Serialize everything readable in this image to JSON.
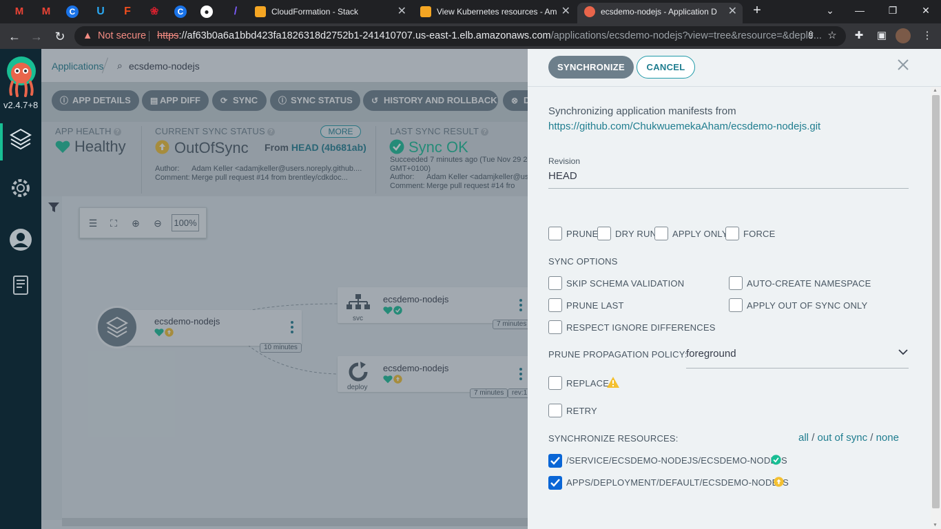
{
  "browser": {
    "pinned_tabs": [
      {
        "icon": "gmail-icon",
        "glyph": "M",
        "color": "#ea4335"
      },
      {
        "icon": "gmail-icon",
        "glyph": "M",
        "color": "#ea4335"
      },
      {
        "icon": "c-app-icon",
        "glyph": "C",
        "color": "#1a73e8"
      },
      {
        "icon": "u-app-icon",
        "glyph": "U",
        "color": "#2aa8f2"
      },
      {
        "icon": "figma-icon",
        "glyph": "F",
        "color": "#f24e1e"
      },
      {
        "icon": "huawei-icon",
        "glyph": "❀",
        "color": "#d1212e"
      },
      {
        "icon": "c-app-icon",
        "glyph": "C",
        "color": "#1a73e8"
      },
      {
        "icon": "github-icon",
        "glyph": "●",
        "color": "#444"
      },
      {
        "icon": "tool-icon",
        "glyph": "/",
        "color": "#7a5af8"
      }
    ],
    "tabs": [
      {
        "title": "CloudFormation - Stack",
        "active": false,
        "icon_color": "#f5a623"
      },
      {
        "title": "View Kubernetes resources - Am",
        "active": false,
        "icon_color": "#f5a623"
      },
      {
        "title": "ecsdemo-nodejs - Application D",
        "active": true,
        "icon_color": "#e9654b"
      }
    ],
    "new_tab": "+",
    "not_secure": "Not secure",
    "url_scheme": "https",
    "url_host": "://af63b0a6a1bbd423fa1826318d2752b1-241410707.us-east-1.elb.amazonaws.com",
    "url_path": "/applications/ecsdemo-nodejs?view=tree&resource=&deplo..."
  },
  "argo_nav": {
    "version": "v2.4.7+8",
    "items": [
      {
        "icon": "layers-icon",
        "active": true
      },
      {
        "icon": "settings-gear-icon",
        "active": false
      },
      {
        "icon": "user-icon",
        "active": false
      },
      {
        "icon": "docs-icon",
        "active": false
      }
    ]
  },
  "main": {
    "breadcrumb": {
      "root": "Applications",
      "current": "ecsdemo-nodejs"
    },
    "actions": [
      {
        "label": "APP DETAILS",
        "icon": "info-icon",
        "glyph": "ⓘ"
      },
      {
        "label": "APP DIFF",
        "icon": "file-icon",
        "glyph": "▤"
      },
      {
        "label": "SYNC",
        "icon": "sync-icon",
        "glyph": "⟳"
      },
      {
        "label": "SYNC STATUS",
        "icon": "info-icon",
        "glyph": "ⓘ"
      },
      {
        "label": "HISTORY AND ROLLBACK",
        "icon": "history-icon",
        "glyph": "↺"
      },
      {
        "label": "D",
        "icon": "delete-icon",
        "glyph": "⊗"
      }
    ],
    "app_health": {
      "title": "APP HEALTH",
      "value": "Healthy"
    },
    "sync_status": {
      "title": "CURRENT SYNC STATUS",
      "more": "MORE",
      "value": "OutOfSync",
      "from_label": "From",
      "revision": "HEAD (4b681ab)",
      "author_label": "Author:",
      "author": "Adam Keller <adamjkeller@users.noreply.github....",
      "comment_label": "Comment:",
      "comment": "Merge pull request #14 from brentley/cdkdoc..."
    },
    "last_sync": {
      "title": "LAST SYNC RESULT",
      "value": "Sync OK",
      "succeeded": "Succeeded 7 minutes ago (Tue Nov 29 2",
      "tz": "GMT+0100)",
      "author_label": "Author:",
      "author": "Adam Keller <adamjkeller@user",
      "comment_label": "Comment:",
      "comment": "Merge pull request #14 fro"
    },
    "zoom": "100%",
    "graph": {
      "app_node": {
        "name": "ecsdemo-nodejs",
        "age": "10 minutes"
      },
      "svc_node": {
        "name": "ecsdemo-nodejs",
        "kind": "svc",
        "age": "7 minutes"
      },
      "deploy_node": {
        "name": "ecsdemo-nodejs",
        "kind": "deploy",
        "age": "7 minutes",
        "rev": "rev:1"
      }
    }
  },
  "panel": {
    "synchronize_label": "SYNCHRONIZE",
    "cancel_label": "CANCEL",
    "intro": "Synchronizing application manifests from",
    "repo_url": "https://github.com/ChukwuemekaAham/ecsdemo-nodejs.git",
    "revision_label": "Revision",
    "revision_value": "HEAD",
    "flags": [
      {
        "label": "PRUNE",
        "checked": false
      },
      {
        "label": "DRY RUN",
        "checked": false
      },
      {
        "label": "APPLY ONLY",
        "checked": false
      },
      {
        "label": "FORCE",
        "checked": false
      }
    ],
    "sync_options_title": "SYNC OPTIONS",
    "sync_options": [
      {
        "label": "SKIP SCHEMA VALIDATION",
        "checked": false
      },
      {
        "label": "AUTO-CREATE NAMESPACE",
        "checked": false
      },
      {
        "label": "PRUNE LAST",
        "checked": false
      },
      {
        "label": "APPLY OUT OF SYNC ONLY",
        "checked": false
      },
      {
        "label": "RESPECT IGNORE DIFFERENCES",
        "checked": false
      }
    ],
    "prune_policy_label": "PRUNE PROPAGATION POLICY:",
    "prune_policy_value": "foreground",
    "replace_label": "REPLACE",
    "retry_label": "RETRY",
    "resources_title": "SYNCHRONIZE RESOURCES:",
    "select_all": "all",
    "select_outofsync": "out of sync",
    "select_none": "none",
    "resources": [
      {
        "label": "/SERVICE/ECSDEMO-NODEJS/ECSDEMO-NODEJS",
        "checked": true,
        "status": "synced"
      },
      {
        "label": "APPS/DEPLOYMENT/DEFAULT/ECSDEMO-NODEJS",
        "checked": true,
        "status": "out-of-sync"
      }
    ],
    "colors": {
      "accent": "#1f9aa8",
      "healthy": "#18be94",
      "outofsync": "#f4c030",
      "checkbox": "#0a66d6"
    }
  }
}
